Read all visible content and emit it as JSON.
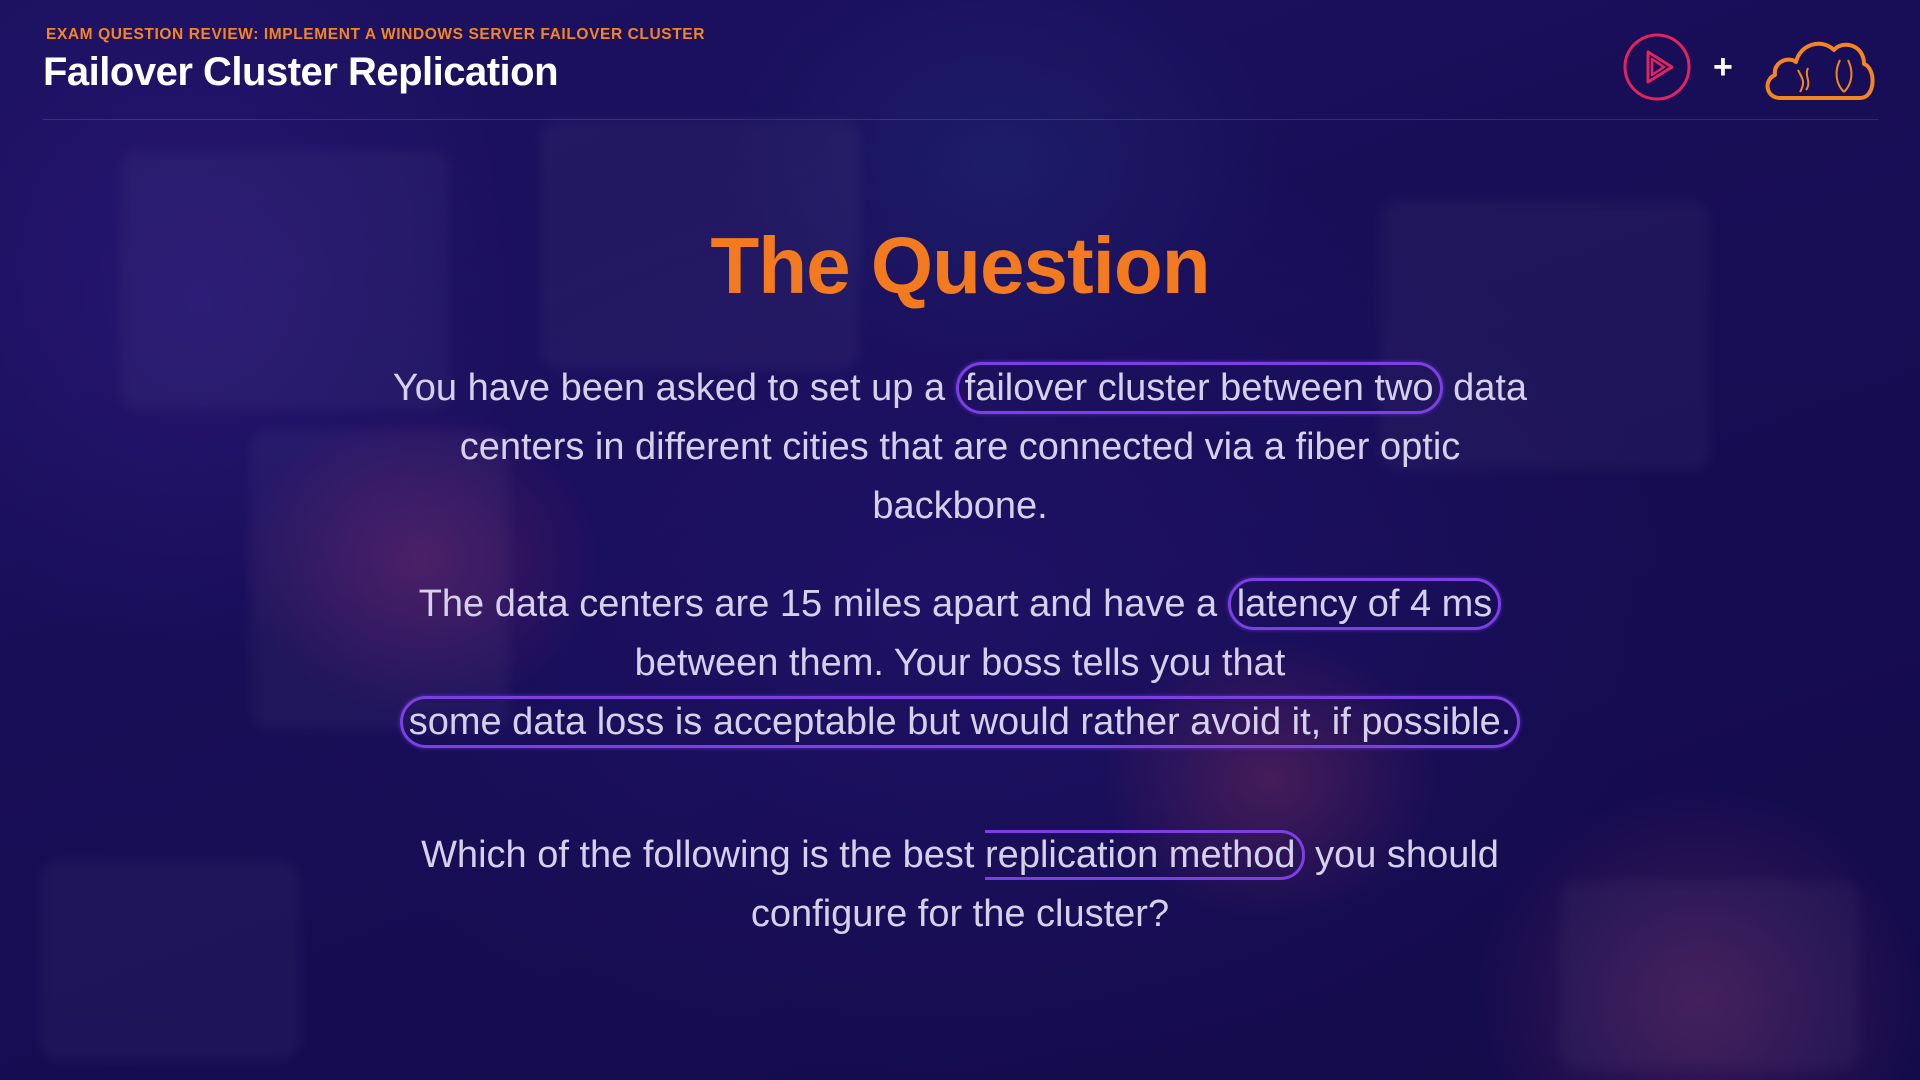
{
  "header": {
    "subtitle": "EXAM QUESTION REVIEW: IMPLEMENT A WINDOWS SERVER FAILOVER CLUSTER",
    "title": "Failover Cluster Replication",
    "plus": "+"
  },
  "logos": {
    "left_icon": "play-circle-icon",
    "right_icon": "cloud-icon",
    "accent": "#f5861f",
    "play_color": "#e0245e"
  },
  "slide": {
    "title": "The Question",
    "p1_a": "You have been asked to set up a",
    "p1_hl": "failover cluster between two",
    "p1_b": "data",
    "p1_line2": "centers in different cities that are connected via a fiber optic",
    "p1_line3": "backbone.",
    "p2_a": "The data centers are 15 miles apart and have a",
    "p2_hl": "latency of 4 ms",
    "p2_line2": "between them. Your boss tells you that",
    "p2_hl2": "some data loss is acceptable but would rather avoid it, if possible.",
    "p3_a": "Which of the following is the best",
    "p3_hl": "replication method",
    "p3_b": "you should",
    "p3_line2": "configure for the cluster?"
  },
  "colors": {
    "title": "#f47a1f",
    "highlight": "#7b3fe4",
    "background": "#1a0f5c"
  }
}
